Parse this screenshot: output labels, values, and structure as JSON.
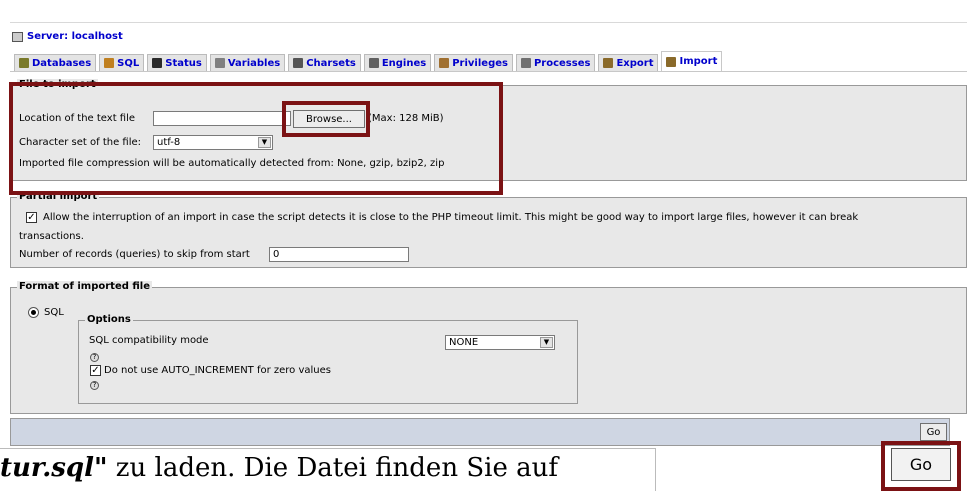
{
  "server": {
    "label": "Server: localhost"
  },
  "tabs": [
    {
      "label": "Databases",
      "icon": "database-icon",
      "color": "#7a7a2a"
    },
    {
      "label": "SQL",
      "icon": "sql-icon",
      "color": "#c08020"
    },
    {
      "label": "Status",
      "icon": "status-icon",
      "color": "#2a2a2a"
    },
    {
      "label": "Variables",
      "icon": "variables-icon",
      "color": "#808080"
    },
    {
      "label": "Charsets",
      "icon": "charsets-icon",
      "color": "#555555"
    },
    {
      "label": "Engines",
      "icon": "engines-icon",
      "color": "#606060"
    },
    {
      "label": "Privileges",
      "icon": "privileges-icon",
      "color": "#a07030"
    },
    {
      "label": "Processes",
      "icon": "processes-icon",
      "color": "#707070"
    },
    {
      "label": "Export",
      "icon": "export-icon",
      "color": "#8a6a2a"
    },
    {
      "label": "Import",
      "icon": "import-icon",
      "color": "#8a6a2a",
      "active": true
    }
  ],
  "file_import": {
    "legend": "File to import",
    "location_label": "Location of the text file",
    "browse_label": "Browse...",
    "max_label": "(Max: 128 MiB)",
    "charset_label": "Character set of the file:",
    "charset_value": "utf-8",
    "compression_note": "Imported file compression will be automatically detected from: None, gzip, bzip2, zip"
  },
  "partial_import": {
    "legend": "Partial import",
    "allow_interrupt_text": "Allow the interruption of an import in case the script detects it is close to the PHP timeout limit. This might be good way to import large files, however it can break",
    "allow_interrupt_text_2": "transactions.",
    "skip_label": "Number of records (queries) to skip from start",
    "skip_value": "0"
  },
  "format": {
    "legend": "Format of imported file",
    "sql_option": "SQL",
    "options_legend": "Options",
    "compat_label": "SQL compatibility mode",
    "compat_value": "NONE",
    "auto_increment_label": "Do not use AUTO_INCREMENT for zero values"
  },
  "go": {
    "label": "Go",
    "label_large": "Go"
  },
  "background_text": {
    "bold_part": "tur.sql\"",
    "rest": " zu laden. Die Datei finden Sie auf"
  },
  "colors": {
    "highlight": "#7b1214",
    "link": "#0000cc",
    "panel": "#e8e8e8",
    "go_bar": "#cfd6e3"
  }
}
